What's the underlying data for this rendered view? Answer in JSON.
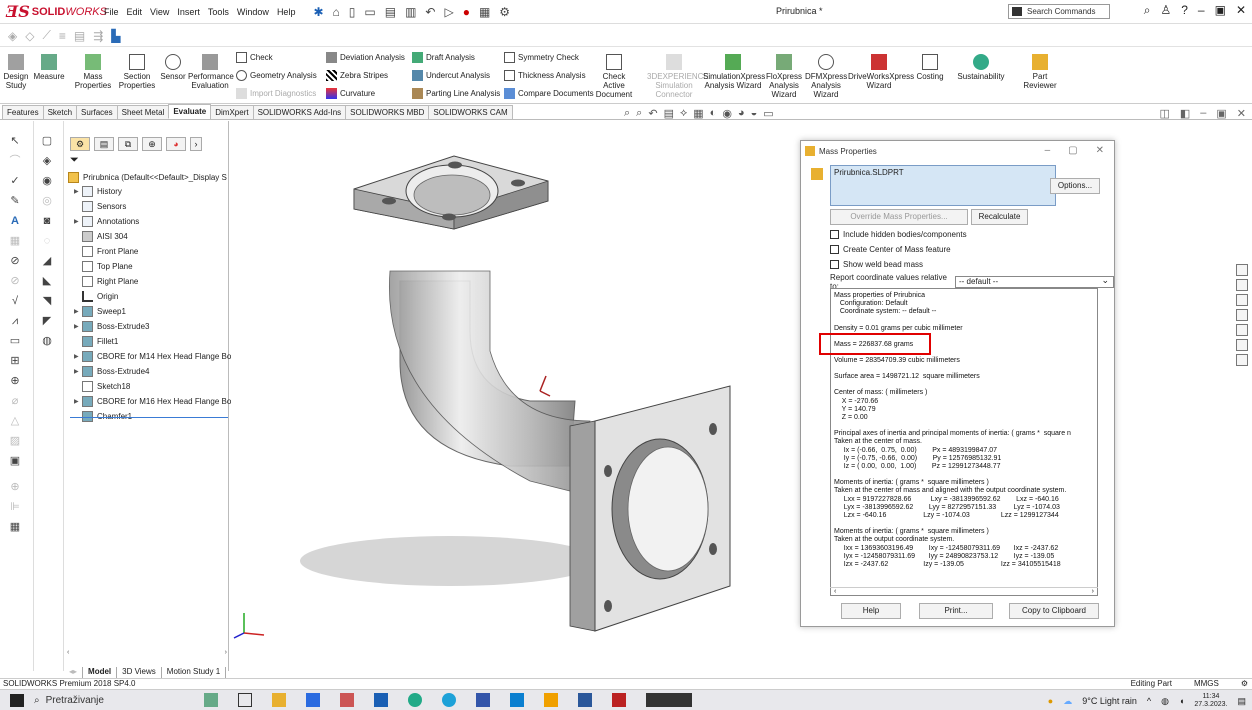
{
  "app": {
    "title": "Prirubnica *",
    "brand_prefix": "SOLID",
    "brand_suffix": "WORKS"
  },
  "menus": [
    "File",
    "Edit",
    "View",
    "Insert",
    "Tools",
    "Window",
    "Help"
  ],
  "search": {
    "label": "Search Commands"
  },
  "command_manager": {
    "design_study": "Design Study",
    "measure": "Measure",
    "mass_properties": "Mass Properties",
    "section_properties": "Section Properties",
    "sensor": "Sensor",
    "performance_evaluation": "Performance Evaluation",
    "check": "Check",
    "geometry_analysis": "Geometry Analysis",
    "import_diagnostics": "Import Diagnostics",
    "deviation_analysis": "Deviation Analysis",
    "zebra_stripes": "Zebra Stripes",
    "curvature": "Curvature",
    "draft_analysis": "Draft Analysis",
    "undercut_analysis": "Undercut Analysis",
    "parting_line_analysis": "Parting Line Analysis",
    "symmetry_check": "Symmetry Check",
    "thickness_analysis": "Thickness Analysis",
    "compare_documents": "Compare Documents",
    "check_active_document": "Check Active Document",
    "experience_sim": "3DEXPERIENCE Simulation Connector",
    "simxpress": "SimulationXpress Analysis Wizard",
    "floxpress": "FloXpress Analysis Wizard",
    "dfmxpress": "DFMXpress Analysis Wizard",
    "driveworks": "DriveWorksXpress Wizard",
    "costing": "Costing",
    "sustainability": "Sustainability",
    "part_reviewer": "Part Reviewer"
  },
  "tabs": [
    "Features",
    "Sketch",
    "Surfaces",
    "Sheet Metal",
    "Evaluate",
    "DimXpert",
    "SOLIDWORKS Add-Ins",
    "SOLIDWORKS MBD",
    "SOLIDWORKS CAM"
  ],
  "tree": {
    "root": "Prirubnica  (Default<<Default>_Display S",
    "items": [
      "History",
      "Sensors",
      "Annotations",
      "AISI 304",
      "Front Plane",
      "Top Plane",
      "Right Plane",
      "Origin",
      "Sweep1",
      "Boss-Extrude3",
      "Fillet1",
      "CBORE for M14 Hex Head Flange Bo",
      "Boss-Extrude4",
      "Sketch18",
      "CBORE for M16 Hex Head Flange Bo",
      "Chamfer1"
    ]
  },
  "bottom_tabs": [
    "Model",
    "3D Views",
    "Motion Study 1"
  ],
  "status": {
    "left": "SOLIDWORKS Premium 2018 SP4.0",
    "mode": "Editing Part",
    "units": "MMGS"
  },
  "taskbar": {
    "search": "Pretraživanje",
    "weather": "9°C  Light rain",
    "time": "11:34",
    "date": "27.3.2023."
  },
  "dialog": {
    "title": "Mass Properties",
    "file": "Prirubnica.SLDPRT",
    "options": "Options...",
    "override": "Override Mass Properties...",
    "recalculate": "Recalculate",
    "chk_hidden": "Include hidden bodies/components",
    "chk_com": "Create Center of Mass feature",
    "chk_weld": "Show weld bead mass",
    "coord_label": "Report coordinate values relative to:",
    "coord_value": "-- default --",
    "results": {
      "l1": "Mass properties of Prirubnica",
      "l2": "   Configuration: Default",
      "l3": "   Coordinate system: -- default --",
      "density": "Density = 0.01 grams per cubic millimeter",
      "mass": "Mass = 226837.68 grams",
      "volume": "Volume = 28354709.39 cubic millimeters",
      "area": "Surface area = 1498721.12  square millimeters",
      "com": "Center of mass: ( millimeters )",
      "cx": "    X = -270.66",
      "cy": "    Y = 140.79",
      "cz": "    Z = 0.00",
      "pa1": "Principal axes of inertia and principal moments of inertia: ( grams *  square n",
      "pa2": "Taken at the center of mass.",
      "pa3": "     Ix = (-0.66,  0.75,  0.00)        Px = 4893199847.07",
      "pa4": "     Iy = (-0.75, -0.66,  0.00)        Py = 12576985132.91",
      "pa5": "     Iz = ( 0.00,  0.00,  1.00)        Pz = 12991273448.77",
      "m1": "Moments of inertia: ( grams *  square millimeters )",
      "m2": "Taken at the center of mass and aligned with the output coordinate system.",
      "m3": "     Lxx = 9197227828.66          Lxy = -3813996592.62        Lxz = -640.16",
      "m4": "     Lyx = -3813996592.62        Lyy = 8272957151.33         Lyz = -1074.03",
      "m5": "     Lzx = -640.16                   Lzy = -1074.03                Lzz = 1299127344",
      "o1": "Moments of inertia: ( grams *  square millimeters )",
      "o2": "Taken at the output coordinate system.",
      "o3": "     Ixx = 13693603196.49        Ixy = -12458079311.69       Ixz = -2437.62",
      "o4": "     Iyx = -12458079311.69       Iyy = 24890823753.12        Iyz = -139.05",
      "o5": "     Izx = -2437.62                  Izy = -139.05                   Izz = 34105515418"
    },
    "help": "Help",
    "print": "Print...",
    "copy": "Copy to Clipboard"
  },
  "colors": {
    "brand": "#c8102e",
    "highlight": "#e00000",
    "file_bg": "#d5e6f5",
    "tree_line": "#3a7bd5"
  }
}
